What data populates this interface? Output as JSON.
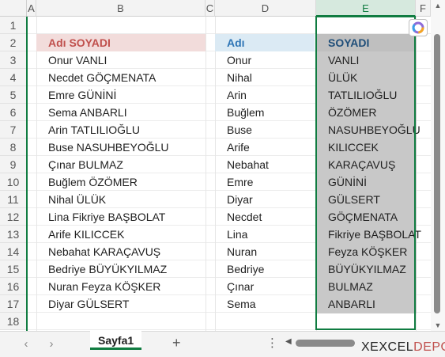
{
  "columns": [
    "A",
    "B",
    "C",
    "D",
    "E",
    "F"
  ],
  "rows": [
    "1",
    "2",
    "3",
    "4",
    "5",
    "6",
    "7",
    "8",
    "9",
    "10",
    "11",
    "12",
    "13",
    "14",
    "15",
    "16",
    "17",
    "18"
  ],
  "headers": {
    "full_name": "Adı SOYADI",
    "first_name": "Adı",
    "last_name": "SOYADI"
  },
  "data": [
    {
      "full": "Onur VANLI",
      "first": "Onur",
      "last": "VANLI"
    },
    {
      "full": "Necdet GÖÇMENATA",
      "first": "Nihal",
      "last": "ÜLÜK"
    },
    {
      "full": "Emre GÜNİNİ",
      "first": "Arin",
      "last": "TATLILIOĞLU"
    },
    {
      "full": "Sema ANBARLI",
      "first": "Buğlem",
      "last": "ÖZÖMER"
    },
    {
      "full": "Arin TATLILIOĞLU",
      "first": "Buse",
      "last": "NASUHBEYOĞLU"
    },
    {
      "full": "Buse NASUHBEYOĞLU",
      "first": "Arife",
      "last": "KILICCEK"
    },
    {
      "full": "Çınar BULMAZ",
      "first": "Nebahat",
      "last": "KARAÇAVUŞ"
    },
    {
      "full": "Buğlem ÖZÖMER",
      "first": "Emre",
      "last": "GÜNİNİ"
    },
    {
      "full": "Nihal ÜLÜK",
      "first": "Diyar",
      "last": "GÜLSERT"
    },
    {
      "full": "Lina Fikriye BAŞBOLAT",
      "first": "Necdet",
      "last": "GÖÇMENATA"
    },
    {
      "full": "Arife KILICCEK",
      "first": "Lina",
      "last": "Fikriye BAŞBOLAT"
    },
    {
      "full": "Nebahat KARAÇAVUŞ",
      "first": "Nuran",
      "last": "Feyza KÖŞKER"
    },
    {
      "full": "Bedriye BÜYÜKYILMAZ",
      "first": "Bedriye",
      "last": "BÜYÜKYILMAZ"
    },
    {
      "full": "Nuran Feyza KÖŞKER",
      "first": "Çınar",
      "last": "BULMAZ"
    },
    {
      "full": "Diyar GÜLSERT",
      "first": "Sema",
      "last": "ANBARLI"
    }
  ],
  "sheet_tab": "Sayfa1",
  "add_sheet": "+",
  "menu": "⋮",
  "nav_prev": "‹",
  "nav_next": "›",
  "logo_prefix": "X",
  "logo_main": "EXCEL",
  "logo_accent": "DEPO",
  "colors": {
    "accent": "#107c41",
    "header_b": "#f2dcdb",
    "header_d": "#dbeaf4",
    "selection": "#c8c8c8"
  }
}
